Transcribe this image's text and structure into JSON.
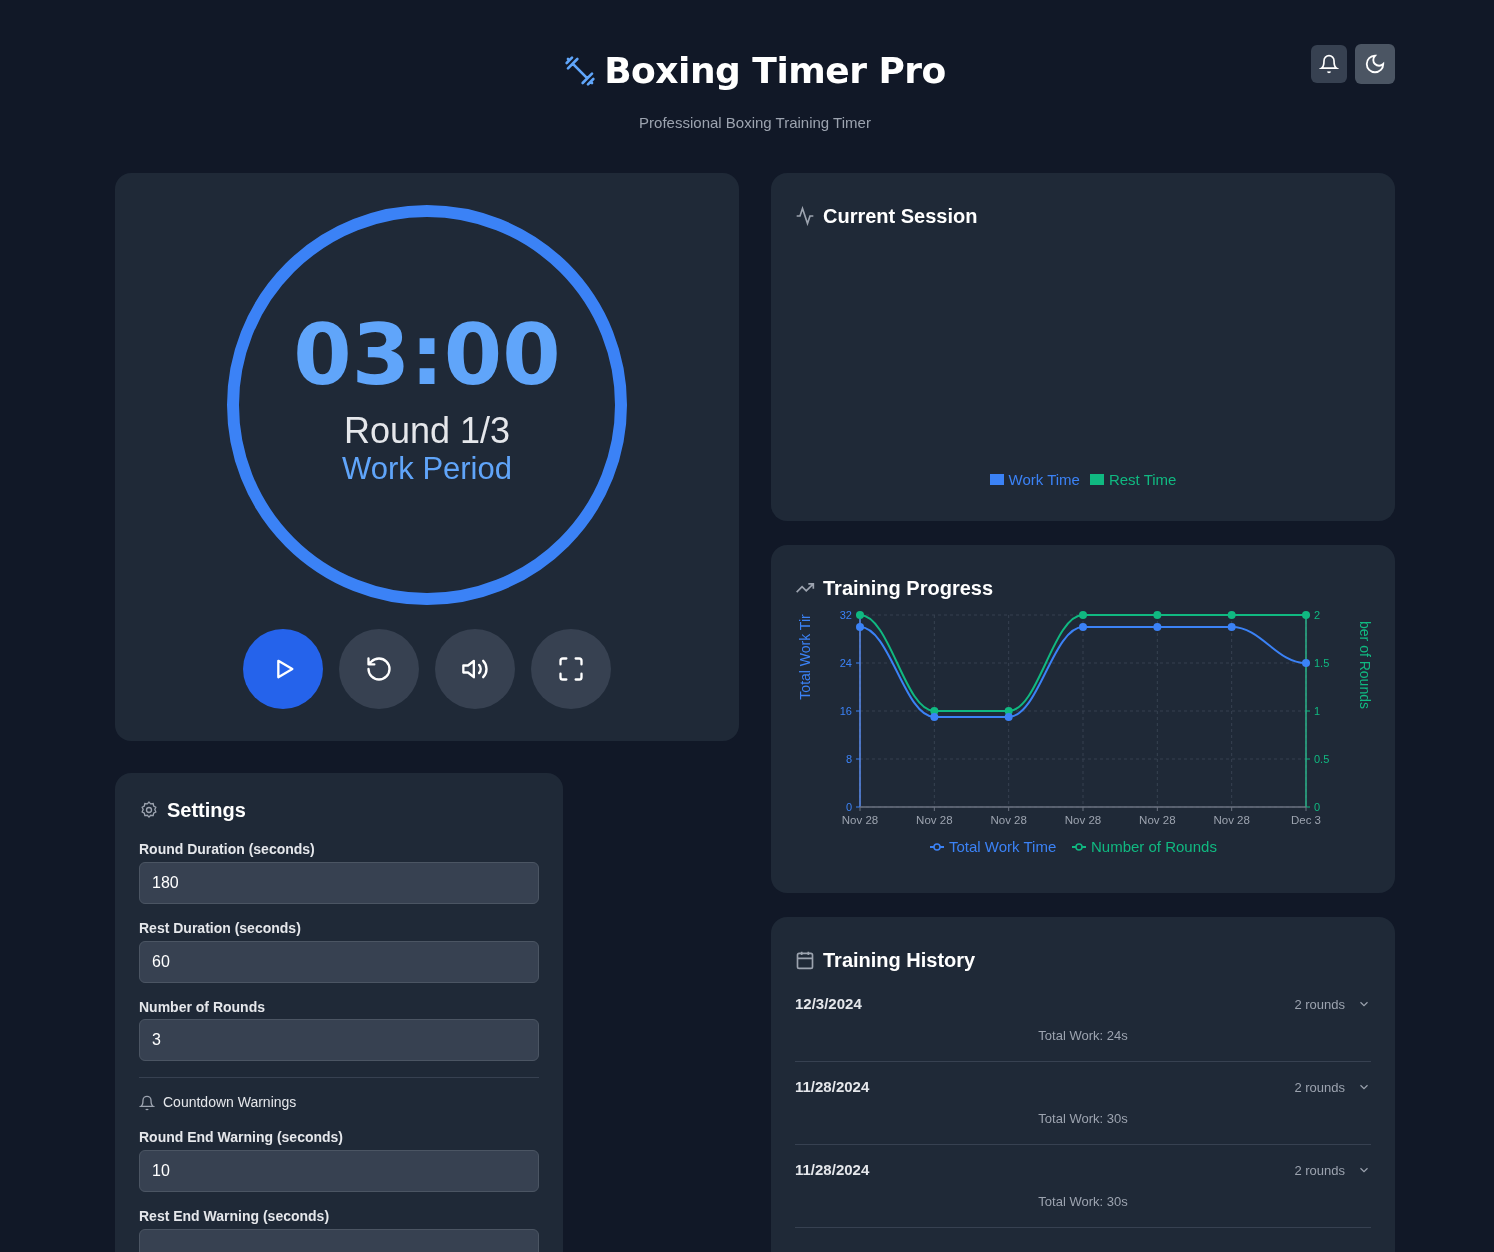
{
  "header": {
    "title": "Boxing Timer Pro",
    "subtitle": "Professional Boxing Training Timer",
    "actions": [
      {
        "kind": "notifications"
      },
      {
        "kind": "theme"
      }
    ]
  },
  "timer": {
    "display": "03:00",
    "round_label": "Round 1/3",
    "period_label": "Work Period",
    "level": 1,
    "controls": [
      {
        "kind": "play"
      },
      {
        "kind": "reset"
      },
      {
        "kind": "sound"
      },
      {
        "kind": "fullscreen"
      }
    ]
  },
  "settings": {
    "title": "Settings",
    "fields": [
      {
        "label": "Round Duration (seconds)",
        "value": "180"
      },
      {
        "label": "Rest Duration (seconds)",
        "value": "60"
      },
      {
        "label": "Number of Rounds",
        "value": "3"
      }
    ],
    "warnings_title": "Countdown Warnings",
    "warning_fields": [
      {
        "label": "Round End Warning (seconds)",
        "value": "10"
      },
      {
        "label": "Rest End Warning (seconds)"
      }
    ]
  },
  "current_session": {
    "title": "Current Session",
    "legend": [
      {
        "label": "Work Time",
        "color": "#3b82f6"
      },
      {
        "label": "Rest Time",
        "color": "#10b981"
      }
    ]
  },
  "training_progress": {
    "title": "Training Progress",
    "chart_data": {
      "type": "line",
      "ylabel": "Total Work Tir",
      "y2label": "ber of Rounds",
      "categories": [
        "Nov 28",
        "Nov 28",
        "Nov 28",
        "Nov 28",
        "Nov 28",
        "Nov 28",
        "Dec 3"
      ],
      "series": [
        {
          "name": "Total Work Time",
          "color": "#3b82f6",
          "marker": "circle",
          "values": [
            30,
            15,
            15,
            30,
            30,
            30,
            24
          ]
        },
        {
          "name": "Number of Rounds",
          "color": "#10b981",
          "axis": "y2",
          "marker": "circle",
          "values": [
            2,
            1,
            1,
            2,
            2,
            2,
            2
          ]
        }
      ],
      "grid": true,
      "legend": "bottom",
      "ylim": [
        0,
        32
      ],
      "yticks": [
        0,
        8,
        16,
        24,
        32
      ],
      "y2lim": [
        0,
        2
      ],
      "y2ticks": [
        0,
        0.5,
        1,
        1.5,
        2
      ]
    }
  },
  "history": {
    "title": "Training History",
    "items": [
      {
        "date": "12/3/2024",
        "rounds": "2 rounds",
        "total": "Total Work: 24s"
      },
      {
        "date": "11/28/2024",
        "rounds": "2 rounds",
        "total": "Total Work: 30s"
      },
      {
        "date": "11/28/2024",
        "rounds": "2 rounds",
        "total": "Total Work: 30s"
      }
    ]
  }
}
